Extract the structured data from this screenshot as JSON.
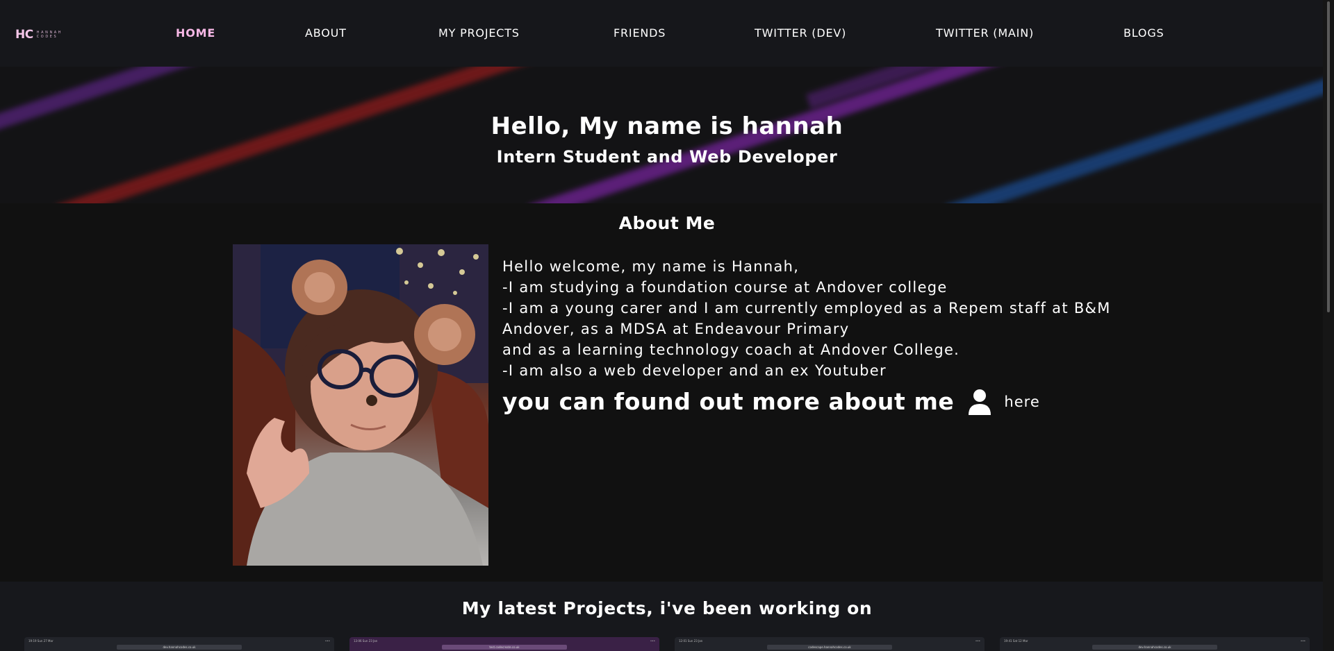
{
  "nav": {
    "logo_mark": "HC",
    "logo_line1": "HANNAH",
    "logo_line2": "CODES",
    "items": [
      {
        "label": "HOME",
        "active": true
      },
      {
        "label": "ABOUT",
        "active": false
      },
      {
        "label": "MY PROJECTS",
        "active": false
      },
      {
        "label": "FRIENDS",
        "active": false
      },
      {
        "label": "TWITTER (DEV)",
        "active": false
      },
      {
        "label": "TWITTER (MAIN)",
        "active": false
      },
      {
        "label": "BLOGS",
        "active": false
      }
    ]
  },
  "hero": {
    "title": "Hello, My name is hannah",
    "subtitle": "Intern Student and Web Developer"
  },
  "about": {
    "heading": "About Me",
    "bio_lines": [
      "Hello welcome, my name is Hannah,",
      "-I am studying a foundation course at Andover college",
      "-I am a young carer and I am currently employed as a Repem staff at B&M",
      "Andover, as a MDSA at Endeavour Primary",
      "and as a learning technology coach at Andover College.",
      "-I am also a web developer and an ex Youtuber"
    ],
    "more_text": "you can found out more about me",
    "more_icon": "person-icon",
    "more_link": "here"
  },
  "projects": {
    "heading": "My latest Projects, i've been working on",
    "thumbnails": [
      {
        "time": "19:19  Sun 27 Mar",
        "url": "dev.hannahcodes.co.uk"
      },
      {
        "time": "13:06  Sun 23 Jan",
        "url": "test.codecreate.co.uk"
      },
      {
        "time": "12:01  Sun 23 Jan",
        "url": "codescape.hannahcodes.co.uk"
      },
      {
        "time": "19:41  Sat 12 Mar",
        "url": "dev.hannahcodes.co.uk"
      }
    ]
  },
  "colors": {
    "nav_bg": "#16171b",
    "active_nav": "#f7b8e6",
    "page_bg": "#111111",
    "text": "#ffffff"
  }
}
